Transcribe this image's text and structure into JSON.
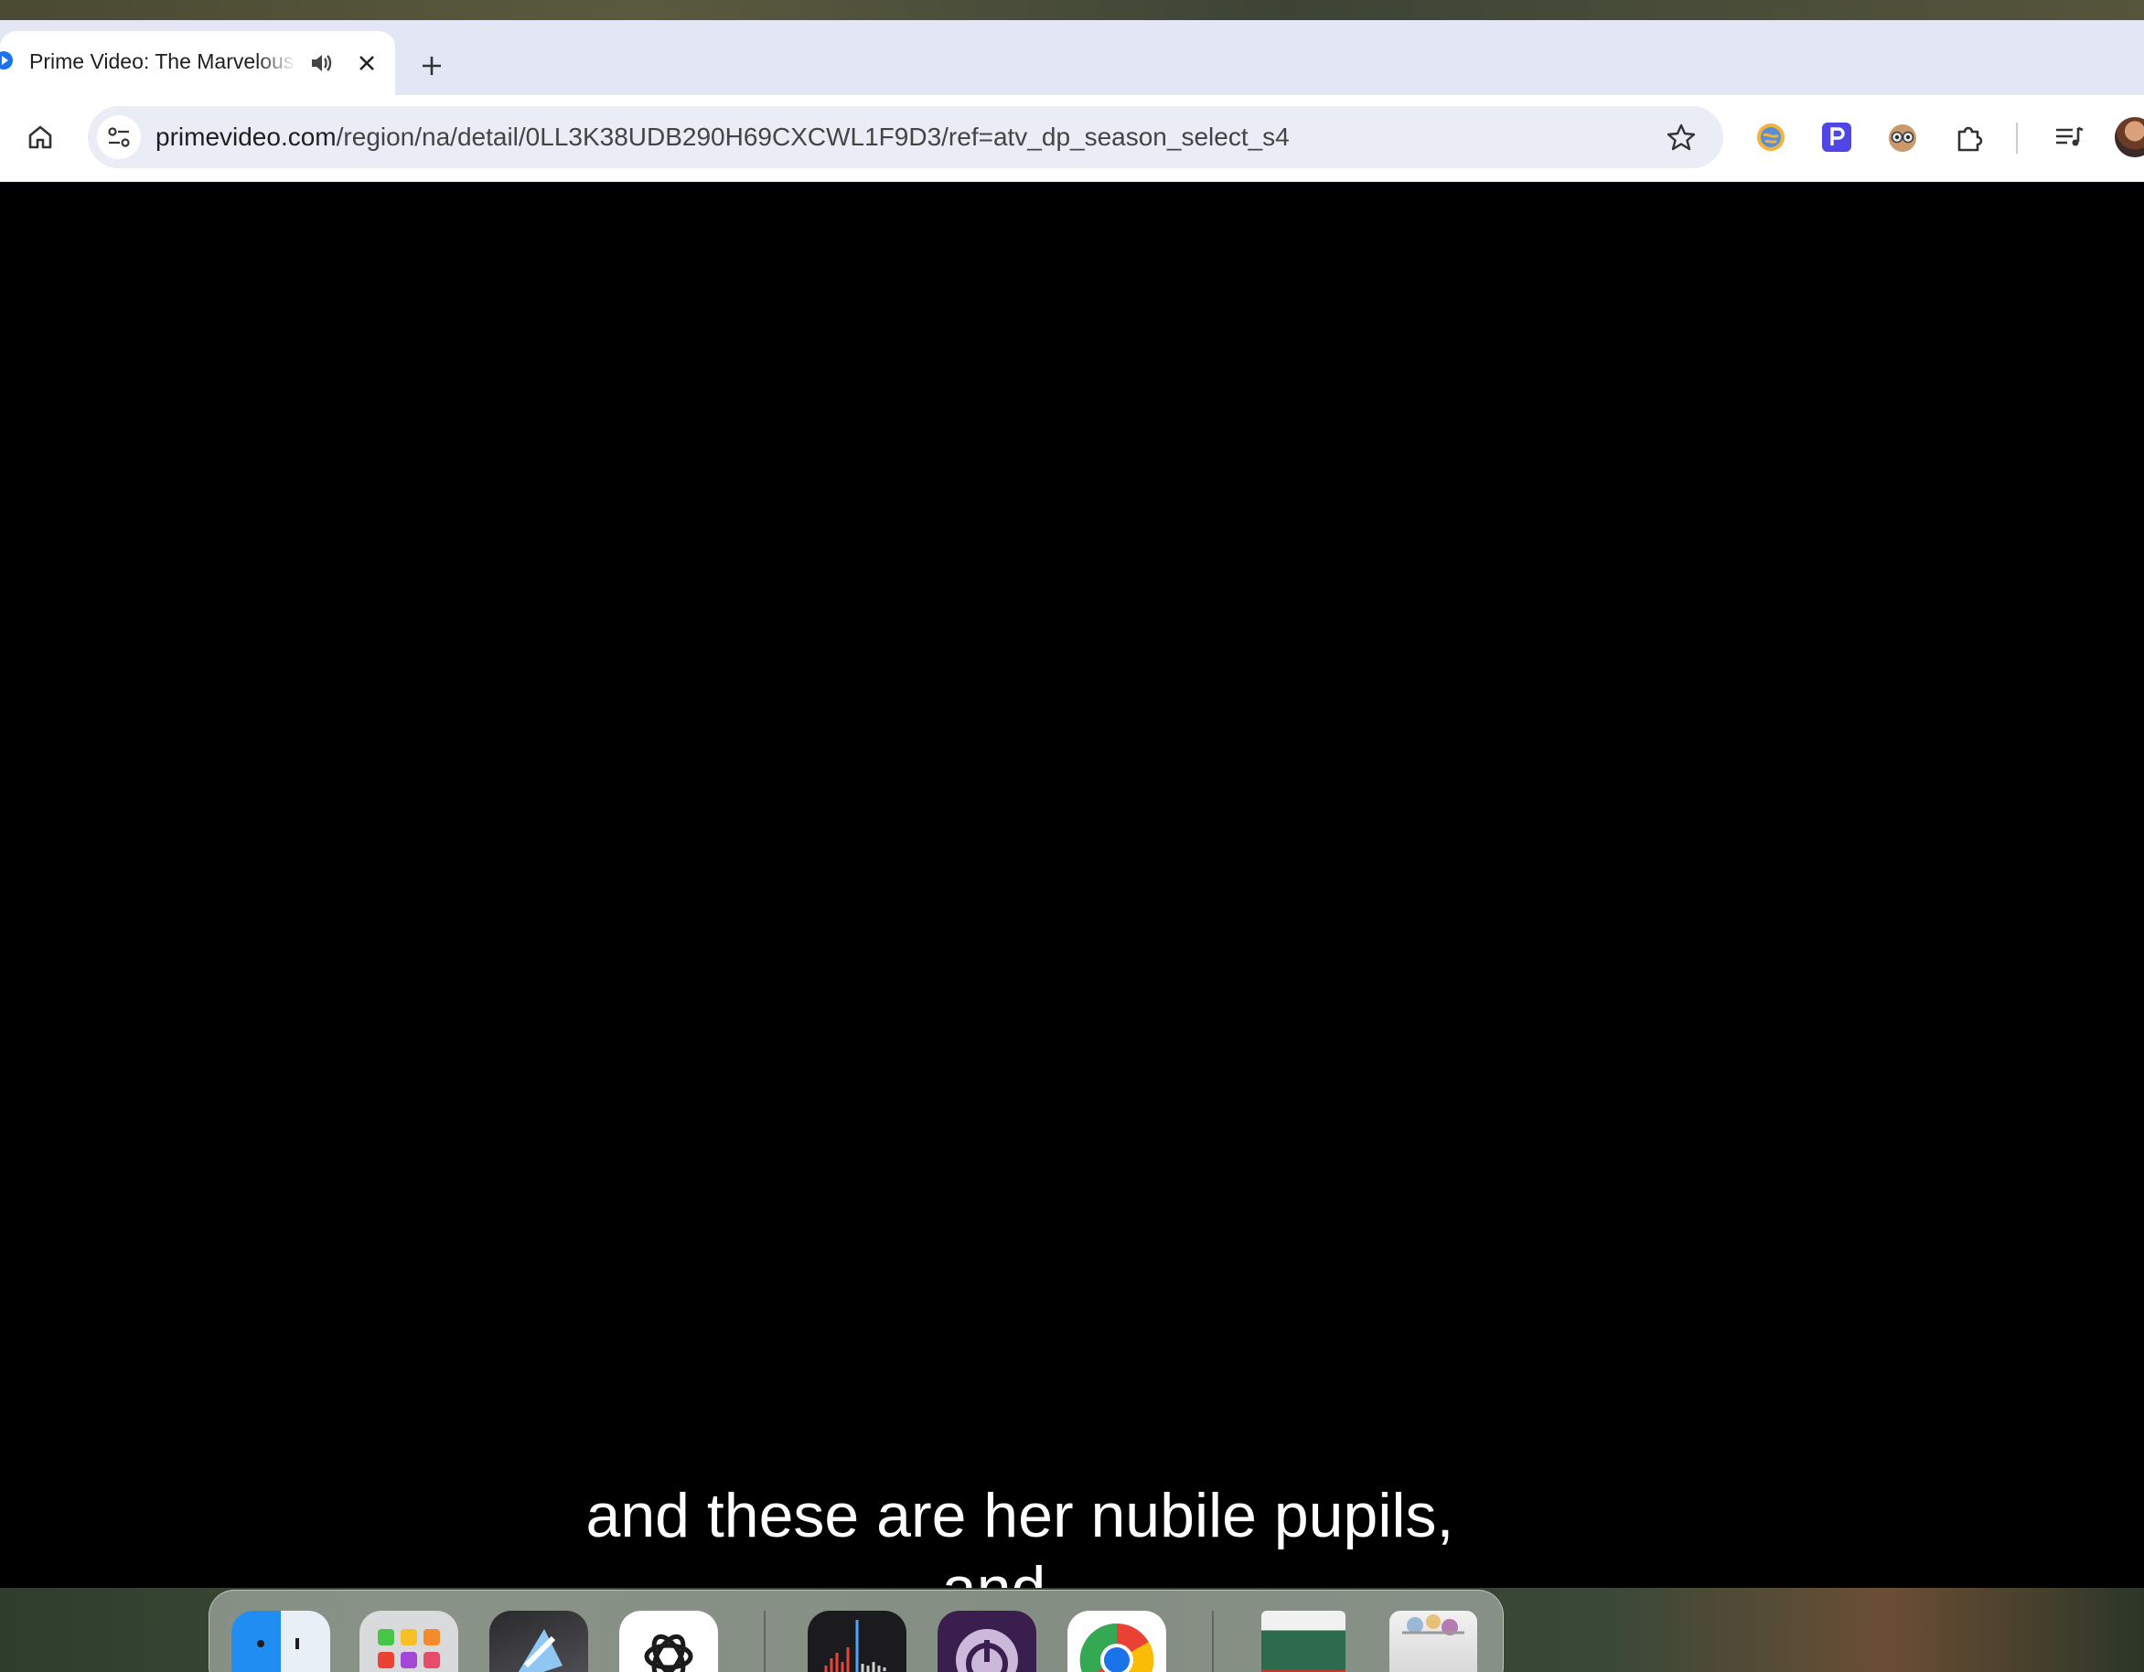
{
  "browser": {
    "tab": {
      "title": "Prime Video: The Marvelous Mrs. Maisel",
      "audio_icon": "speaker-icon",
      "close_icon": "close-icon"
    },
    "new_tab_icon": "plus-icon",
    "toolbar": {
      "home_icon": "home-icon",
      "site_info_icon": "tune-icon",
      "url_host": "primevideo.com",
      "url_path": "/region/na/detail/0LL3K38UDB290H69CXCWL1F9D3/ref=atv_dp_season_select_s4",
      "bookmark_icon": "star-icon",
      "extensions": [
        "globe-extension-icon",
        "p-extension-icon",
        "owl-extension-icon",
        "puzzle-icon"
      ],
      "media_icon": "media-queue-icon",
      "profile_icon": "avatar"
    }
  },
  "video": {
    "subtitle_line_1": "and these are her nubile pupils,",
    "subtitle_line_2": "and..."
  },
  "dock": {
    "apps": [
      "finder-icon",
      "launchpad-icon",
      "app-icon",
      "chatgpt-icon",
      "voice-memos-icon",
      "power-app-icon",
      "chrome-icon",
      "book-icon",
      "trash-icon"
    ]
  },
  "colors": {
    "tabstrip": "#e3e6f4",
    "omnibox": "#ebedf6",
    "video_bg": "#000000",
    "subtitle": "#ffffff"
  }
}
